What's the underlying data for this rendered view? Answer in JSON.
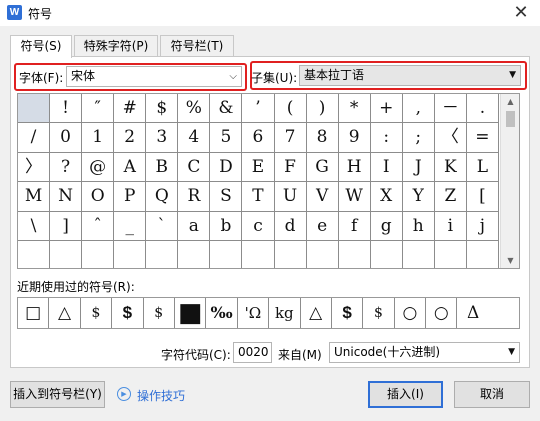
{
  "window": {
    "title": "符号",
    "app_icon": "W",
    "close_glyph": "✕"
  },
  "tabs": [
    {
      "label": "符号(S)",
      "active": true
    },
    {
      "label": "特殊字符(P)",
      "active": false
    },
    {
      "label": "符号栏(T)",
      "active": false
    }
  ],
  "font": {
    "label": "字体(F):",
    "value": "宋体"
  },
  "subset": {
    "label": "子集(U):",
    "value": "基本拉丁语"
  },
  "symbol_grid": {
    "rows": [
      [
        " ",
        "!",
        "″",
        "#",
        "$",
        "%",
        "&",
        "’",
        "(",
        ")",
        "*",
        "+",
        ",",
        "－",
        "."
      ],
      [
        "/",
        "0",
        "1",
        "2",
        "3",
        "4",
        "5",
        "6",
        "7",
        "8",
        "9",
        ":",
        ";",
        "〈",
        "="
      ],
      [
        "〉",
        "?",
        "@",
        "A",
        "B",
        "C",
        "D",
        "E",
        "F",
        "G",
        "H",
        "I",
        "J",
        "K",
        "L"
      ],
      [
        "M",
        "N",
        "O",
        "P",
        "Q",
        "R",
        "S",
        "T",
        "U",
        "V",
        "W",
        "X",
        "Y",
        "Z",
        "["
      ],
      [
        "\\",
        "]",
        "ˆ",
        "_",
        "`",
        "a",
        "b",
        "c",
        "d",
        "e",
        "f",
        "g",
        "h",
        "i",
        "j"
      ],
      [
        "",
        "",
        "",
        "",
        "",
        "",
        "",
        "",
        "",
        "",
        "",
        "",
        "",
        "",
        ""
      ]
    ],
    "selected": [
      0,
      0
    ]
  },
  "recent": {
    "label": "近期使用过的符号(R):",
    "symbols": [
      "□",
      "△",
      "$",
      "$",
      "$",
      "■",
      "‰",
      "'Ω",
      "kg",
      "△",
      "$",
      "$",
      "○",
      "○",
      "Δ"
    ]
  },
  "char_code": {
    "label": "字符代码(C):",
    "value": "0020"
  },
  "from": {
    "label": "来自(M)",
    "value": "Unicode(十六进制)"
  },
  "buttons": {
    "insert_to_bar": "插入到符号栏(Y)",
    "tips": "操作技巧",
    "insert": "插入(I)",
    "cancel": "取消"
  },
  "colors": {
    "highlight": "#e02020",
    "accent": "#2f6fd6",
    "selected_cell": "#d5dce6"
  }
}
